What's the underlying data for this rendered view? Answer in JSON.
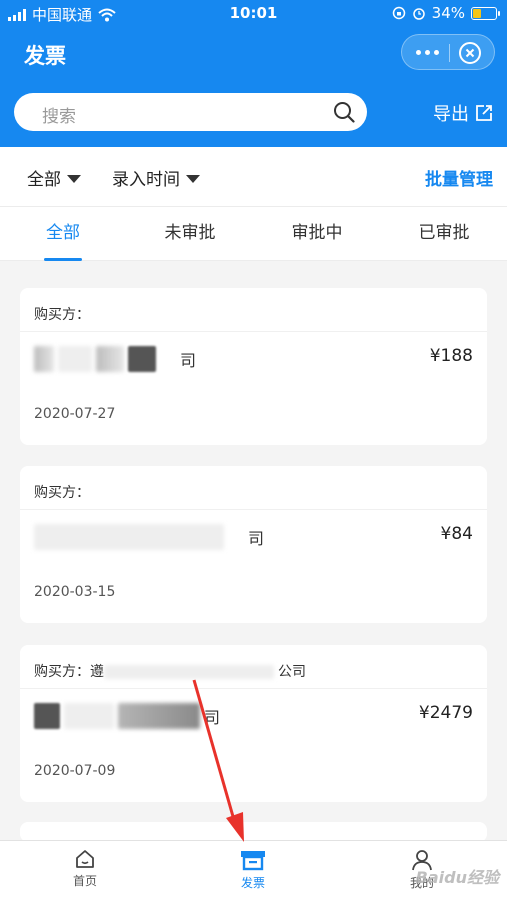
{
  "status_bar": {
    "carrier": "中国联通",
    "time": "10:01",
    "battery": "34%"
  },
  "nav": {
    "title": "发票"
  },
  "search": {
    "placeholder": "搜索",
    "export_label": "导出"
  },
  "filters": {
    "scope": "全部",
    "sort": "录入时间",
    "batch_label": "批量管理"
  },
  "tabs": [
    "全部",
    "未审批",
    "审批中",
    "已审批"
  ],
  "active_tab": 0,
  "invoices": [
    {
      "buyer_label": "购买方：",
      "buyer_fragment": "",
      "seller_fragment": "司",
      "amount": "¥188",
      "date": "2020-07-27"
    },
    {
      "buyer_label": "购买方：",
      "buyer_fragment": "",
      "seller_fragment": "司",
      "amount": "¥84",
      "date": "2020-03-15"
    },
    {
      "buyer_label": "购买方：",
      "buyer_fragment": "遵",
      "buyer_suffix": "公司",
      "seller_fragment": "司",
      "amount": "¥2479",
      "date": "2020-07-09"
    }
  ],
  "bottom_nav": [
    {
      "label": "首页",
      "icon": "home-icon"
    },
    {
      "label": "发票",
      "icon": "invoice-icon"
    },
    {
      "label": "我的",
      "icon": "user-icon"
    }
  ],
  "colors": {
    "brand": "#1688f0",
    "background": "#f4f4f4",
    "annotation_arrow": "#e8322b"
  },
  "watermark": "Baidu经验"
}
